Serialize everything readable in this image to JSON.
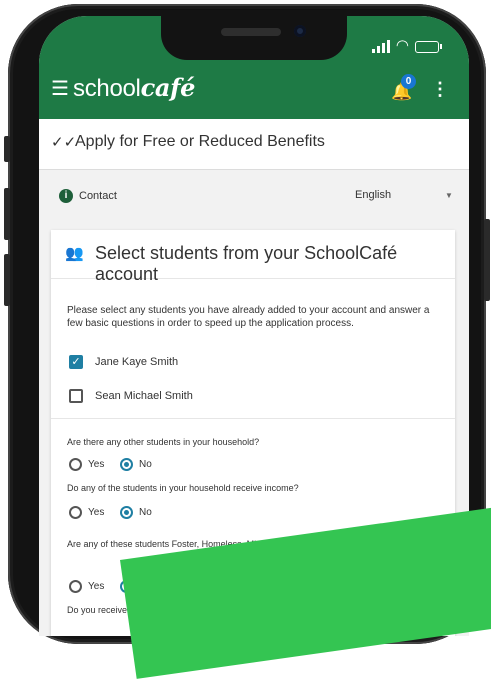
{
  "app": {
    "logo_plain": "school",
    "logo_brand": "café",
    "notification_count": "0",
    "brand_color": "#1e7a45",
    "icons": [
      "menu-icon",
      "bell-icon",
      "more-vert-icon",
      "checkmark-icon",
      "info-icon",
      "people-icon"
    ]
  },
  "page": {
    "title": "Apply for Free or Reduced Benefits"
  },
  "contact": {
    "label": "Contact",
    "language": "English"
  },
  "card": {
    "title": "Select students from your SchoolCafé account",
    "instructions": "Please select any students you have already added to your account and answer a few basic questions in order to speed up the application process.",
    "students": [
      {
        "name": "Jane Kaye Smith",
        "checked": true
      },
      {
        "name": "Sean Michael Smith",
        "checked": false
      }
    ],
    "questions": [
      {
        "text": "Are there any other students in your household?",
        "yes": "Yes",
        "no": "No",
        "selected": "No"
      },
      {
        "text": "Do any of the students in your household receive income?",
        "yes": "Yes",
        "no": "No",
        "selected": "No"
      },
      {
        "text": "Are any of these students Foster, Homeless, Migrant, Runaway, or Head Start children?",
        "yes": "Yes",
        "no": "No",
        "selected": "No"
      },
      {
        "text": "Do you receive any assistance from SNAP, TANF, or FDPIR?"
      }
    ]
  }
}
